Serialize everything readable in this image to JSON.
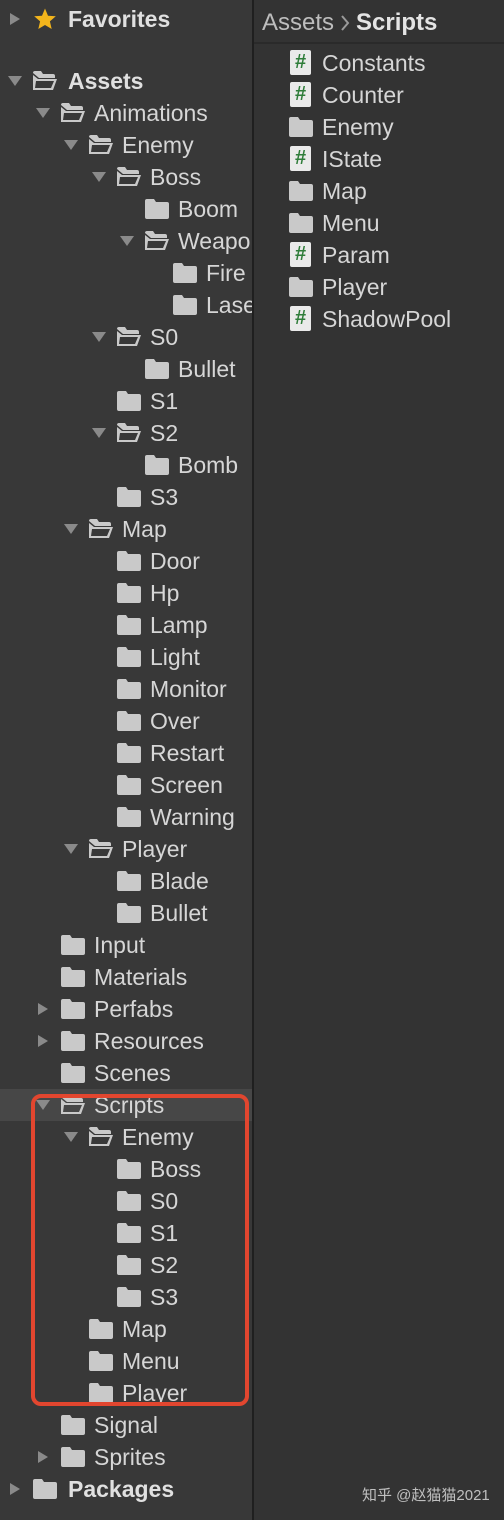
{
  "hierarchy": {
    "favorites_label": "Favorites",
    "assets_label": "Assets",
    "packages_label": "Packages",
    "items": [
      {
        "label": "Animations",
        "depth": 1,
        "arrow": "expanded",
        "folder": "open"
      },
      {
        "label": "Enemy",
        "depth": 2,
        "arrow": "expanded",
        "folder": "open"
      },
      {
        "label": "Boss",
        "depth": 3,
        "arrow": "expanded",
        "folder": "open"
      },
      {
        "label": "Boom",
        "depth": 4,
        "arrow": "none",
        "folder": "closed"
      },
      {
        "label": "Weapon",
        "depth": 4,
        "arrow": "expanded",
        "folder": "open"
      },
      {
        "label": "Fire",
        "depth": 5,
        "arrow": "none",
        "folder": "closed"
      },
      {
        "label": "Laser",
        "depth": 5,
        "arrow": "none",
        "folder": "closed"
      },
      {
        "label": "S0",
        "depth": 3,
        "arrow": "expanded",
        "folder": "open"
      },
      {
        "label": "Bullet",
        "depth": 4,
        "arrow": "none",
        "folder": "closed"
      },
      {
        "label": "S1",
        "depth": 3,
        "arrow": "none",
        "folder": "closed"
      },
      {
        "label": "S2",
        "depth": 3,
        "arrow": "expanded",
        "folder": "open"
      },
      {
        "label": "Bomb",
        "depth": 4,
        "arrow": "none",
        "folder": "closed"
      },
      {
        "label": "S3",
        "depth": 3,
        "arrow": "none",
        "folder": "closed"
      },
      {
        "label": "Map",
        "depth": 2,
        "arrow": "expanded",
        "folder": "open"
      },
      {
        "label": "Door",
        "depth": 3,
        "arrow": "none",
        "folder": "closed"
      },
      {
        "label": "Hp",
        "depth": 3,
        "arrow": "none",
        "folder": "closed"
      },
      {
        "label": "Lamp",
        "depth": 3,
        "arrow": "none",
        "folder": "closed"
      },
      {
        "label": "Light",
        "depth": 3,
        "arrow": "none",
        "folder": "closed"
      },
      {
        "label": "Monitor",
        "depth": 3,
        "arrow": "none",
        "folder": "closed"
      },
      {
        "label": "Over",
        "depth": 3,
        "arrow": "none",
        "folder": "closed"
      },
      {
        "label": "Restart",
        "depth": 3,
        "arrow": "none",
        "folder": "closed"
      },
      {
        "label": "Screen",
        "depth": 3,
        "arrow": "none",
        "folder": "closed"
      },
      {
        "label": "Warning",
        "depth": 3,
        "arrow": "none",
        "folder": "closed"
      },
      {
        "label": "Player",
        "depth": 2,
        "arrow": "expanded",
        "folder": "open"
      },
      {
        "label": "Blade",
        "depth": 3,
        "arrow": "none",
        "folder": "closed"
      },
      {
        "label": "Bullet",
        "depth": 3,
        "arrow": "none",
        "folder": "closed"
      },
      {
        "label": "Input",
        "depth": 1,
        "arrow": "none",
        "folder": "closed"
      },
      {
        "label": "Materials",
        "depth": 1,
        "arrow": "none",
        "folder": "closed"
      },
      {
        "label": "Perfabs",
        "depth": 1,
        "arrow": "collapsed",
        "folder": "closed"
      },
      {
        "label": "Resources",
        "depth": 1,
        "arrow": "collapsed",
        "folder": "closed"
      },
      {
        "label": "Scenes",
        "depth": 1,
        "arrow": "none",
        "folder": "closed"
      },
      {
        "label": "Scripts",
        "depth": 1,
        "arrow": "expanded",
        "folder": "open",
        "selected": true
      },
      {
        "label": "Enemy",
        "depth": 2,
        "arrow": "expanded",
        "folder": "open"
      },
      {
        "label": "Boss",
        "depth": 3,
        "arrow": "none",
        "folder": "closed"
      },
      {
        "label": "S0",
        "depth": 3,
        "arrow": "none",
        "folder": "closed"
      },
      {
        "label": "S1",
        "depth": 3,
        "arrow": "none",
        "folder": "closed"
      },
      {
        "label": "S2",
        "depth": 3,
        "arrow": "none",
        "folder": "closed"
      },
      {
        "label": "S3",
        "depth": 3,
        "arrow": "none",
        "folder": "closed"
      },
      {
        "label": "Map",
        "depth": 2,
        "arrow": "none",
        "folder": "closed"
      },
      {
        "label": "Menu",
        "depth": 2,
        "arrow": "none",
        "folder": "closed"
      },
      {
        "label": "Player",
        "depth": 2,
        "arrow": "none",
        "folder": "closed"
      },
      {
        "label": "Signal",
        "depth": 1,
        "arrow": "none",
        "folder": "closed"
      },
      {
        "label": "Sprites",
        "depth": 1,
        "arrow": "collapsed",
        "folder": "closed"
      }
    ]
  },
  "breadcrumb": {
    "root": "Assets",
    "current": "Scripts"
  },
  "project_items": [
    {
      "name": "Constants",
      "type": "script"
    },
    {
      "name": "Counter",
      "type": "script"
    },
    {
      "name": "Enemy",
      "type": "folder"
    },
    {
      "name": "IState",
      "type": "script"
    },
    {
      "name": "Map",
      "type": "folder"
    },
    {
      "name": "Menu",
      "type": "folder"
    },
    {
      "name": "Param",
      "type": "script"
    },
    {
      "name": "Player",
      "type": "folder"
    },
    {
      "name": "ShadowPool",
      "type": "script"
    }
  ],
  "watermark": "知乎 @赵猫猫2021",
  "colors": {
    "highlight": "#e2462f",
    "script_hash": "#2f7d3a",
    "star": "#f3b51c"
  }
}
